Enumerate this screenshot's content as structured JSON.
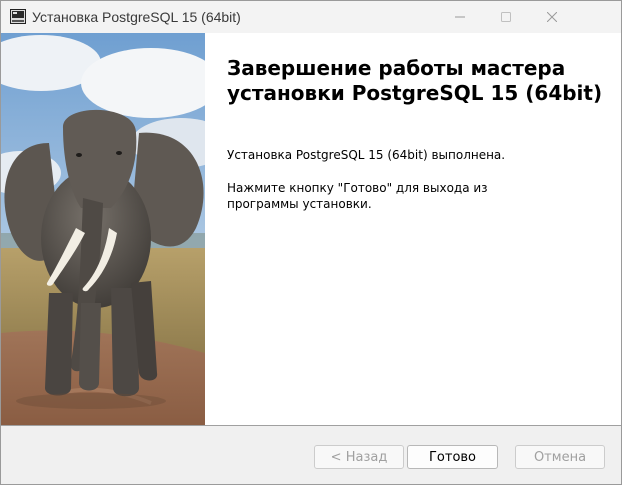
{
  "window": {
    "title": "Установка PostgreSQL 15 (64bit)"
  },
  "titlebar": {
    "app_icon": "installer-icon",
    "minimize_icon": "minimize-icon",
    "maximize_icon": "maximize-icon",
    "close_icon": "close-icon"
  },
  "sidebar": {
    "image": "elephant-photo"
  },
  "main": {
    "heading": "Завершение работы мастера установки PostgreSQL 15 (64bit)",
    "message_done": "Установка PostgreSQL 15 (64bit) выполнена.",
    "message_exit": "Нажмите кнопку \"Готово\" для выхода из программы установки."
  },
  "footer": {
    "back_label": "< Назад",
    "finish_label": "Готово",
    "cancel_label": "Отмена"
  },
  "colors": {
    "titlebar_bg": "#f3f3f3",
    "footer_bg": "#f0f0f0",
    "disabled_text": "#a0a0a0"
  }
}
